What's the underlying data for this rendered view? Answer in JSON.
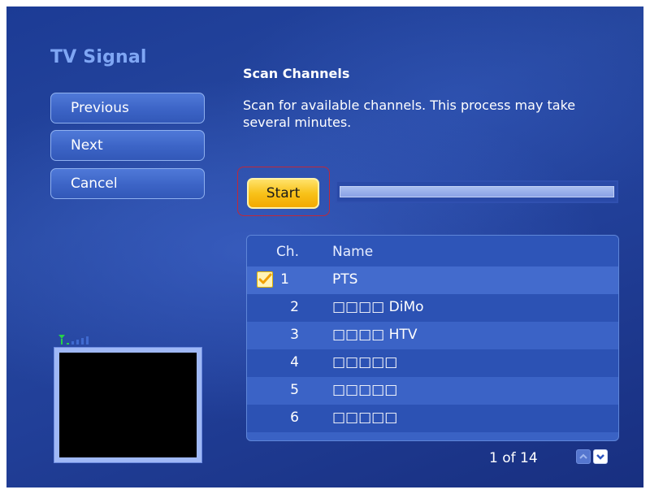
{
  "wizard": {
    "section_title": "TV Signal",
    "nav_buttons": {
      "previous": "Previous",
      "next": "Next",
      "cancel": "Cancel"
    }
  },
  "page": {
    "title": "Scan Channels",
    "description": "Scan for available channels. This process may take several minutes."
  },
  "scan": {
    "start_label": "Start",
    "progress_percent": 0
  },
  "channel_list": {
    "headers": {
      "channel": "Ch.",
      "name": "Name"
    },
    "rows": [
      {
        "channel": "1",
        "name": "PTS",
        "checked": true
      },
      {
        "channel": "2",
        "name": "□□□□ DiMo",
        "checked": false
      },
      {
        "channel": "3",
        "name": "□□□□ HTV",
        "checked": false
      },
      {
        "channel": "4",
        "name": "□□□□□",
        "checked": false
      },
      {
        "channel": "5",
        "name": "□□□□□",
        "checked": false
      },
      {
        "channel": "6",
        "name": "□□□□□",
        "checked": false
      }
    ]
  },
  "pagination": {
    "indicator": "1 of 14"
  },
  "colors": {
    "accent_title": "#7fa6f4",
    "start_button": "#f8c21a",
    "focus_outline": "#c0283a",
    "signal_green": "#27d14a"
  },
  "icons": {
    "signal": "signal-strength-icon",
    "checkbox": "checkmark-icon",
    "up": "chevron-up-icon",
    "down": "chevron-down-icon"
  }
}
